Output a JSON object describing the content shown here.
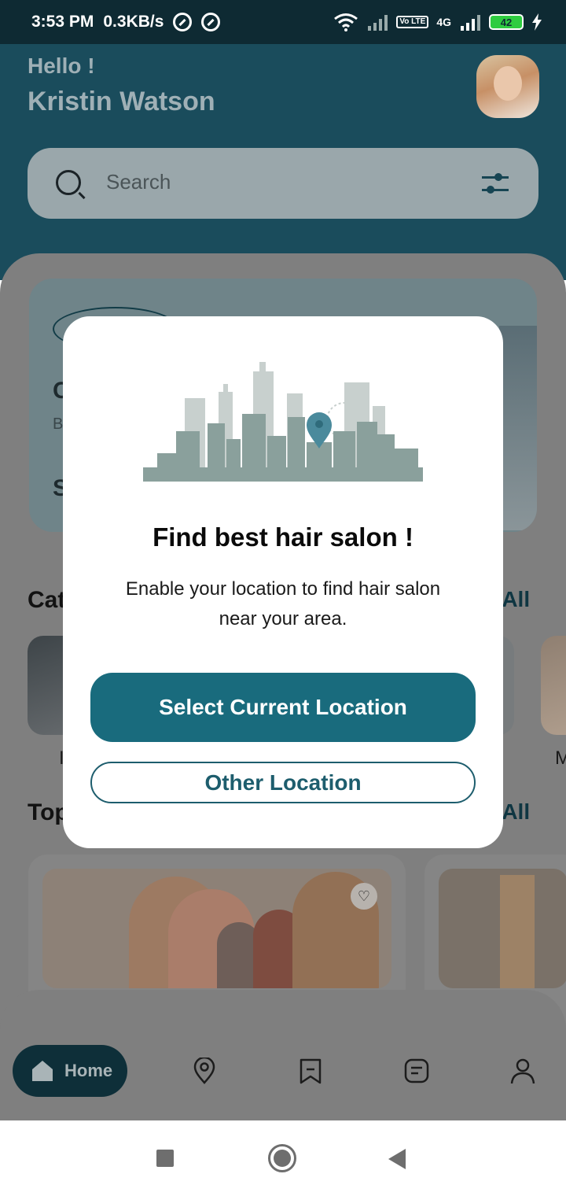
{
  "status_bar": {
    "time": "3:53 PM",
    "speed": "0.3KB/s",
    "network": "4G",
    "lte": "Vo LTE",
    "battery": "42"
  },
  "header": {
    "greeting": "Hello !",
    "username": "Kristin Watson"
  },
  "search": {
    "placeholder": "Search"
  },
  "banner": {
    "line1": "C",
    "line2": "B",
    "line3": "S"
  },
  "sections": {
    "categories_title": "Cat",
    "categories_see_all": "e All",
    "top_title": "Top",
    "top_see_all": "e All"
  },
  "categories": {
    "labels": [
      "I",
      "M"
    ]
  },
  "modal": {
    "title": "Find best hair salon !",
    "text": "Enable your location to find hair salon near your area.",
    "primary_button": "Select Current Location",
    "secondary_button": "Other Location"
  },
  "bottom_nav": {
    "home_label": "Home"
  },
  "colors": {
    "header": "#1a4c5c",
    "accent": "#196b7d",
    "status_bar": "#0e2a33"
  }
}
